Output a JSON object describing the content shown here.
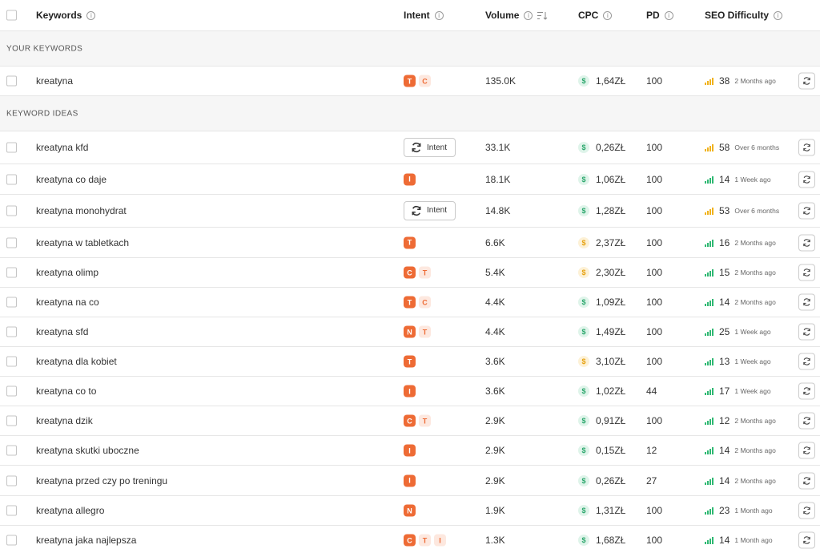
{
  "header": {
    "keywords": "Keywords",
    "intent": "Intent",
    "volume": "Volume",
    "cpc": "CPC",
    "pd": "PD",
    "seo": "SEO Difficulty"
  },
  "sections": {
    "your_keywords": "YOUR KEYWORDS",
    "keyword_ideas": "KEYWORD IDEAS"
  },
  "intent_button_label": "Intent",
  "rows": [
    {
      "keyword": "kreatyna",
      "intent": [
        "T",
        "C"
      ],
      "volume": "135.0K",
      "cpc": "1,64ZŁ",
      "cpc_color": "green",
      "pd": "100",
      "seo": "38",
      "seo_color": "yellow",
      "updated": "2 Months ago"
    },
    {
      "keyword": "kreatyna kfd",
      "intent_button": true,
      "volume": "33.1K",
      "cpc": "0,26ZŁ",
      "cpc_color": "green",
      "pd": "100",
      "seo": "58",
      "seo_color": "yellow",
      "updated": "Over 6 months"
    },
    {
      "keyword": "kreatyna co daje",
      "intent": [
        "I"
      ],
      "volume": "18.1K",
      "cpc": "1,06ZŁ",
      "cpc_color": "green",
      "pd": "100",
      "seo": "14",
      "seo_color": "green",
      "updated": "1 Week ago"
    },
    {
      "keyword": "kreatyna monohydrat",
      "intent_button": true,
      "volume": "14.8K",
      "cpc": "1,28ZŁ",
      "cpc_color": "green",
      "pd": "100",
      "seo": "53",
      "seo_color": "yellow",
      "updated": "Over 6 months"
    },
    {
      "keyword": "kreatyna w tabletkach",
      "intent": [
        "T"
      ],
      "volume": "6.6K",
      "cpc": "2,37ZŁ",
      "cpc_color": "yellow",
      "pd": "100",
      "seo": "16",
      "seo_color": "green",
      "updated": "2 Months ago"
    },
    {
      "keyword": "kreatyna olimp",
      "intent": [
        "C",
        "T"
      ],
      "volume": "5.4K",
      "cpc": "2,30ZŁ",
      "cpc_color": "yellow",
      "pd": "100",
      "seo": "15",
      "seo_color": "green",
      "updated": "2 Months ago"
    },
    {
      "keyword": "kreatyna na co",
      "intent": [
        "T",
        "C"
      ],
      "volume": "4.4K",
      "cpc": "1,09ZŁ",
      "cpc_color": "green",
      "pd": "100",
      "seo": "14",
      "seo_color": "green",
      "updated": "2 Months ago"
    },
    {
      "keyword": "kreatyna sfd",
      "intent": [
        "N",
        "T"
      ],
      "volume": "4.4K",
      "cpc": "1,49ZŁ",
      "cpc_color": "green",
      "pd": "100",
      "seo": "25",
      "seo_color": "green",
      "updated": "1 Week ago"
    },
    {
      "keyword": "kreatyna dla kobiet",
      "intent": [
        "T"
      ],
      "volume": "3.6K",
      "cpc": "3,10ZŁ",
      "cpc_color": "yellow",
      "pd": "100",
      "seo": "13",
      "seo_color": "green",
      "updated": "1 Week ago"
    },
    {
      "keyword": "kreatyna co to",
      "intent": [
        "I"
      ],
      "volume": "3.6K",
      "cpc": "1,02ZŁ",
      "cpc_color": "green",
      "pd": "44",
      "seo": "17",
      "seo_color": "green",
      "updated": "1 Week ago"
    },
    {
      "keyword": "kreatyna dzik",
      "intent": [
        "C",
        "T"
      ],
      "volume": "2.9K",
      "cpc": "0,91ZŁ",
      "cpc_color": "green",
      "pd": "100",
      "seo": "12",
      "seo_color": "green",
      "updated": "2 Months ago"
    },
    {
      "keyword": "kreatyna skutki uboczne",
      "intent": [
        "I"
      ],
      "volume": "2.9K",
      "cpc": "0,15ZŁ",
      "cpc_color": "green",
      "pd": "12",
      "seo": "14",
      "seo_color": "green",
      "updated": "2 Months ago"
    },
    {
      "keyword": "kreatyna przed czy po treningu",
      "intent": [
        "I"
      ],
      "volume": "2.9K",
      "cpc": "0,26ZŁ",
      "cpc_color": "green",
      "pd": "27",
      "seo": "14",
      "seo_color": "green",
      "updated": "2 Months ago"
    },
    {
      "keyword": "kreatyna allegro",
      "intent": [
        "N"
      ],
      "volume": "1.9K",
      "cpc": "1,31ZŁ",
      "cpc_color": "green",
      "pd": "100",
      "seo": "23",
      "seo_color": "green",
      "updated": "1 Month ago"
    },
    {
      "keyword": "kreatyna jaka najlepsza",
      "intent": [
        "C",
        "T",
        "I"
      ],
      "volume": "1.3K",
      "cpc": "1,68ZŁ",
      "cpc_color": "green",
      "pd": "100",
      "seo": "14",
      "seo_color": "green",
      "updated": "1 Month ago"
    }
  ]
}
